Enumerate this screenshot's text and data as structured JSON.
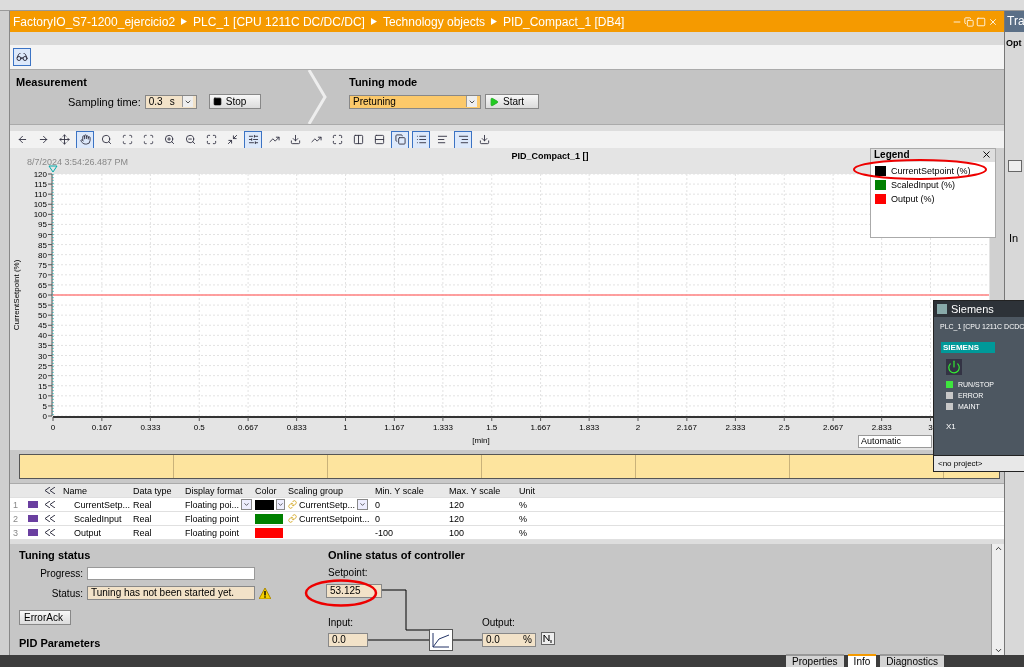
{
  "breadcrumb": [
    "FactoryIO_S7-1200_ejercicio2",
    "PLC_1 [CPU 1211C DC/DC/DC]",
    "Technology objects",
    "PID_Compact_1 [DB4]"
  ],
  "right_panel": {
    "title": "Tra",
    "tab": "Opt",
    "checked": false,
    "section": "In"
  },
  "measurement": {
    "title": "Measurement",
    "sampling_label": "Sampling time:",
    "sampling_value": "0.3",
    "sampling_unit": "s",
    "stop_button": "Stop"
  },
  "tuning_mode": {
    "title": "Tuning mode",
    "mode": "Pretuning",
    "start_button": "Start"
  },
  "trend": {
    "timestamp": "8/7/2024  3:54:26.487 PM",
    "x_mode": "Automatic",
    "chart_data": {
      "type": "line",
      "title": "PID_Compact_1 []",
      "xlabel": "[min]",
      "ylabel": "CurrentSetpoint (%)",
      "x": [
        0,
        3.2
      ],
      "series": [
        {
          "color": "#ff8080",
          "values": [
            60,
            60
          ]
        }
      ],
      "grid": true,
      "xlim": [
        0,
        3.2
      ],
      "ylim": [
        0,
        120
      ],
      "xticks": [
        0,
        0.167,
        0.333,
        0.5,
        0.667,
        0.833,
        1,
        1.167,
        1.333,
        1.5,
        1.667,
        1.833,
        2,
        2.167,
        2.333,
        2.5,
        2.667,
        2.833,
        3
      ],
      "yticks": [
        0,
        5,
        10,
        15,
        20,
        25,
        30,
        35,
        40,
        45,
        50,
        55,
        60,
        65,
        70,
        75,
        80,
        85,
        90,
        95,
        100,
        105,
        110,
        115,
        120
      ]
    },
    "legend": {
      "title": "Legend",
      "items": [
        {
          "label": "CurrentSetpoint (%)",
          "color": "#000000"
        },
        {
          "label": "ScaledInput (%)",
          "color": "#008000"
        },
        {
          "label": "Output (%)",
          "color": "#ff0000"
        }
      ]
    }
  },
  "signals": {
    "columns": [
      "Name",
      "Data type",
      "Display format",
      "Color",
      "Scaling group",
      "Min. Y scale",
      "Max. Y scale",
      "Unit"
    ],
    "rows": [
      {
        "index": "1",
        "name": "CurrentSetp...",
        "data_type": "Real",
        "display_format": "Floating poi...",
        "format_dropdown": true,
        "color": "#000000",
        "color_dropdown": true,
        "linked": true,
        "scaling_group": "CurrentSetp...",
        "group_dropdown": true,
        "min": "0",
        "max": "120",
        "unit": "%"
      },
      {
        "index": "2",
        "name": "ScaledInput",
        "data_type": "Real",
        "display_format": "Floating point",
        "format_dropdown": false,
        "color": "#008000",
        "color_dropdown": false,
        "linked": true,
        "scaling_group": "CurrentSetpoint...",
        "group_dropdown": false,
        "min": "0",
        "max": "120",
        "unit": "%"
      },
      {
        "index": "3",
        "name": "Output",
        "data_type": "Real",
        "display_format": "Floating point",
        "format_dropdown": false,
        "color": "#ff0000",
        "color_dropdown": false,
        "linked": false,
        "min": "-100",
        "max": "100",
        "unit": "%"
      }
    ]
  },
  "tuning_status": {
    "title": "Tuning status",
    "progress_label": "Progress:",
    "progress": {
      "level": 0
    },
    "status_label": "Status:",
    "status": "Tuning has not been started yet.",
    "warning": true,
    "errorack_button": "ErrorAck"
  },
  "pid_parameters": {
    "title": "PID Parameters"
  },
  "online_status": {
    "title": "Online status of controller",
    "setpoint_label": "Setpoint:",
    "setpoint": "53.125",
    "input_label": "Input:",
    "input": "0.0",
    "output_label": "Output:",
    "output": "0.0",
    "output_unit": "%"
  },
  "bottom_tabs": [
    {
      "label": "Properties",
      "selected": false
    },
    {
      "label": "Info",
      "selected": true
    },
    {
      "label": "Diagnostics",
      "selected": false
    }
  ],
  "plcsim": {
    "title": "Siemens",
    "device": "PLC_1 [CPU 1211C DCDC",
    "brand": "SIEMENS",
    "leds": [
      {
        "label": "RUN/STOP",
        "on": true
      },
      {
        "label": "ERROR",
        "on": false
      },
      {
        "label": "MAINT",
        "on": false
      }
    ],
    "port": "X1",
    "project": "<no project>"
  }
}
